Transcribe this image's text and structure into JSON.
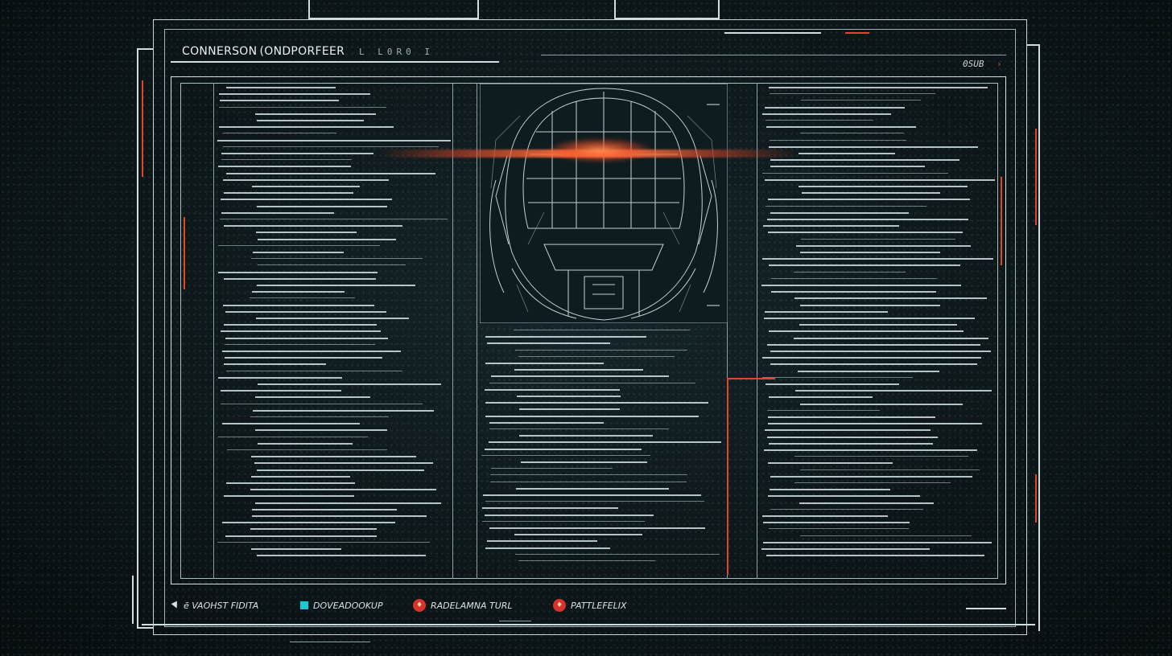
{
  "header": {
    "title": "CONNERSON (ONDPORFEER",
    "subtitle": "L L0R0 I",
    "corner_tag": "0SUB"
  },
  "legend": [
    {
      "label": "ē VAOHST FIDITA",
      "icon": "triangle-icon"
    },
    {
      "label": "DOVEADOOKUP",
      "icon": "cyan-square-icon"
    },
    {
      "label": "RADELAMNA TURL",
      "icon": "red-circle-icon"
    },
    {
      "label": "PATTLEFELIX",
      "icon": "red-circle-icon"
    }
  ],
  "colors": {
    "line": "#cfdde0",
    "accent": "#e0472a",
    "cyan": "#1fc7d6",
    "background": "#0b1416"
  },
  "center_image": {
    "icon": "helmet-wireframe-icon"
  }
}
